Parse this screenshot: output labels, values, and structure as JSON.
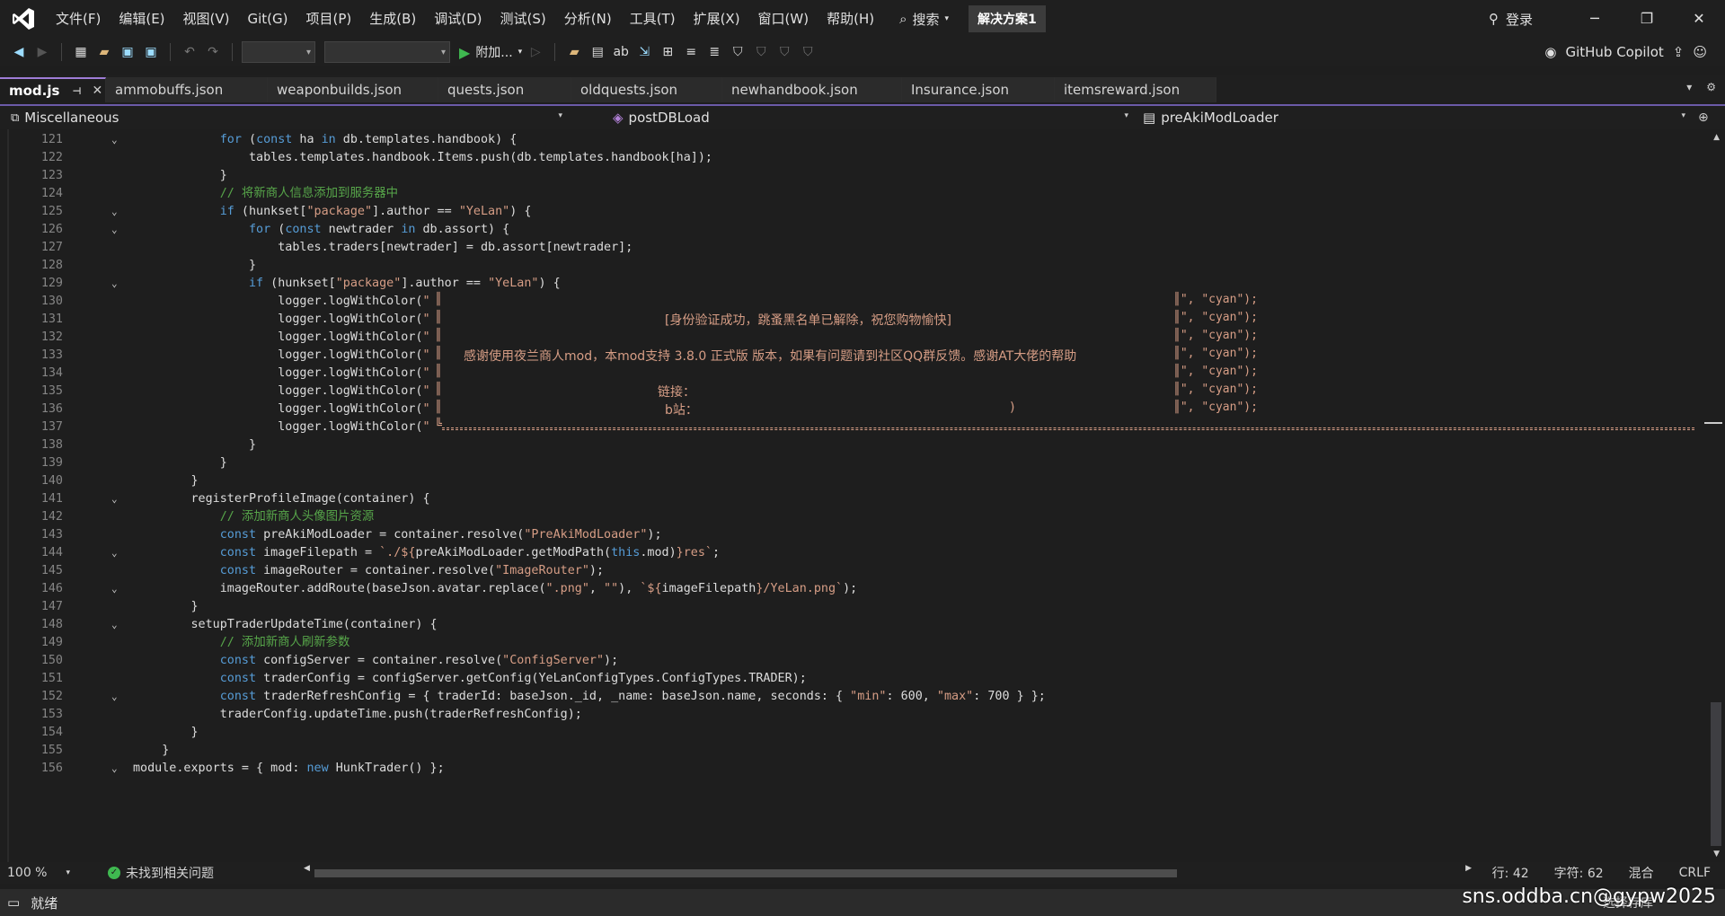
{
  "menu": {
    "items": [
      "文件(F)",
      "编辑(E)",
      "视图(V)",
      "Git(G)",
      "项目(P)",
      "生成(B)",
      "调试(D)",
      "测试(S)",
      "分析(N)",
      "工具(T)",
      "扩展(X)",
      "窗口(W)",
      "帮助(H)"
    ],
    "search_label": "搜索",
    "solution_name": "解决方案1",
    "login_label": "登录"
  },
  "toolbar": {
    "attach_label": "附加...",
    "copilot_label": "GitHub Copilot"
  },
  "tabs": [
    {
      "label": "mod.js",
      "active": true
    },
    {
      "label": "ammobuffs.json",
      "active": false
    },
    {
      "label": "weaponbuilds.json",
      "active": false
    },
    {
      "label": "quests.json",
      "active": false
    },
    {
      "label": "oldquests.json",
      "active": false
    },
    {
      "label": "newhandbook.json",
      "active": false
    },
    {
      "label": "Insurance.json",
      "active": false
    },
    {
      "label": "itemsreward.json",
      "active": false
    }
  ],
  "nav": {
    "project": "Miscellaneous",
    "member": "postDBLoad",
    "scope": "preAkiModLoader"
  },
  "box": {
    "line131": "[身份验证成功，跳蚤黑名单已解除，祝您购物愉快]",
    "line133": "感谢使用夜兰商人mod，本mod支持 3.8.0 正式版 版本，如果有问题请到社区QQ群反馈。感谢AT大佬的帮助",
    "line135": "链接：",
    "line136": "b站：",
    "line136_paren": ")"
  },
  "status": {
    "zoom": "100 %",
    "issues": "未找到相关问题",
    "line": "行: 42",
    "char": "字符: 62",
    "mixed": "混合",
    "eol": "CRLF",
    "ready": "就绪",
    "select_repo": "选择存库"
  },
  "watermark": "sns.oddba.cn@gypw2025"
}
